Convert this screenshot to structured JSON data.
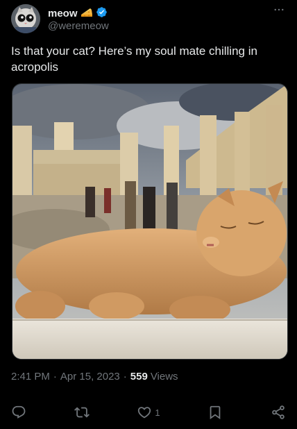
{
  "author": {
    "display_name": "meow",
    "handle": "@weremeow",
    "emoji_icon": "cheese-wedge-icon",
    "verified_icon": "verified-badge-icon",
    "verified_color": "#1d9bf0"
  },
  "tweet": {
    "text": "Is that your cat? Here’s my soul mate chilling in acropolis",
    "time": "2:41 PM",
    "separator": "·",
    "date": "Apr 15, 2023",
    "views_count": "559",
    "views_label": "Views"
  },
  "media": {
    "icon": "photo-cat-acropolis"
  },
  "actions": {
    "reply_icon": "reply-icon",
    "retweet_icon": "retweet-icon",
    "like_icon": "heart-icon",
    "like_count": "1",
    "bookmark_icon": "bookmark-icon",
    "share_icon": "share-icon"
  },
  "colors": {
    "background": "#000000",
    "text_primary": "#e7e9ea",
    "text_secondary": "#71767b",
    "accent": "#1d9bf0"
  }
}
